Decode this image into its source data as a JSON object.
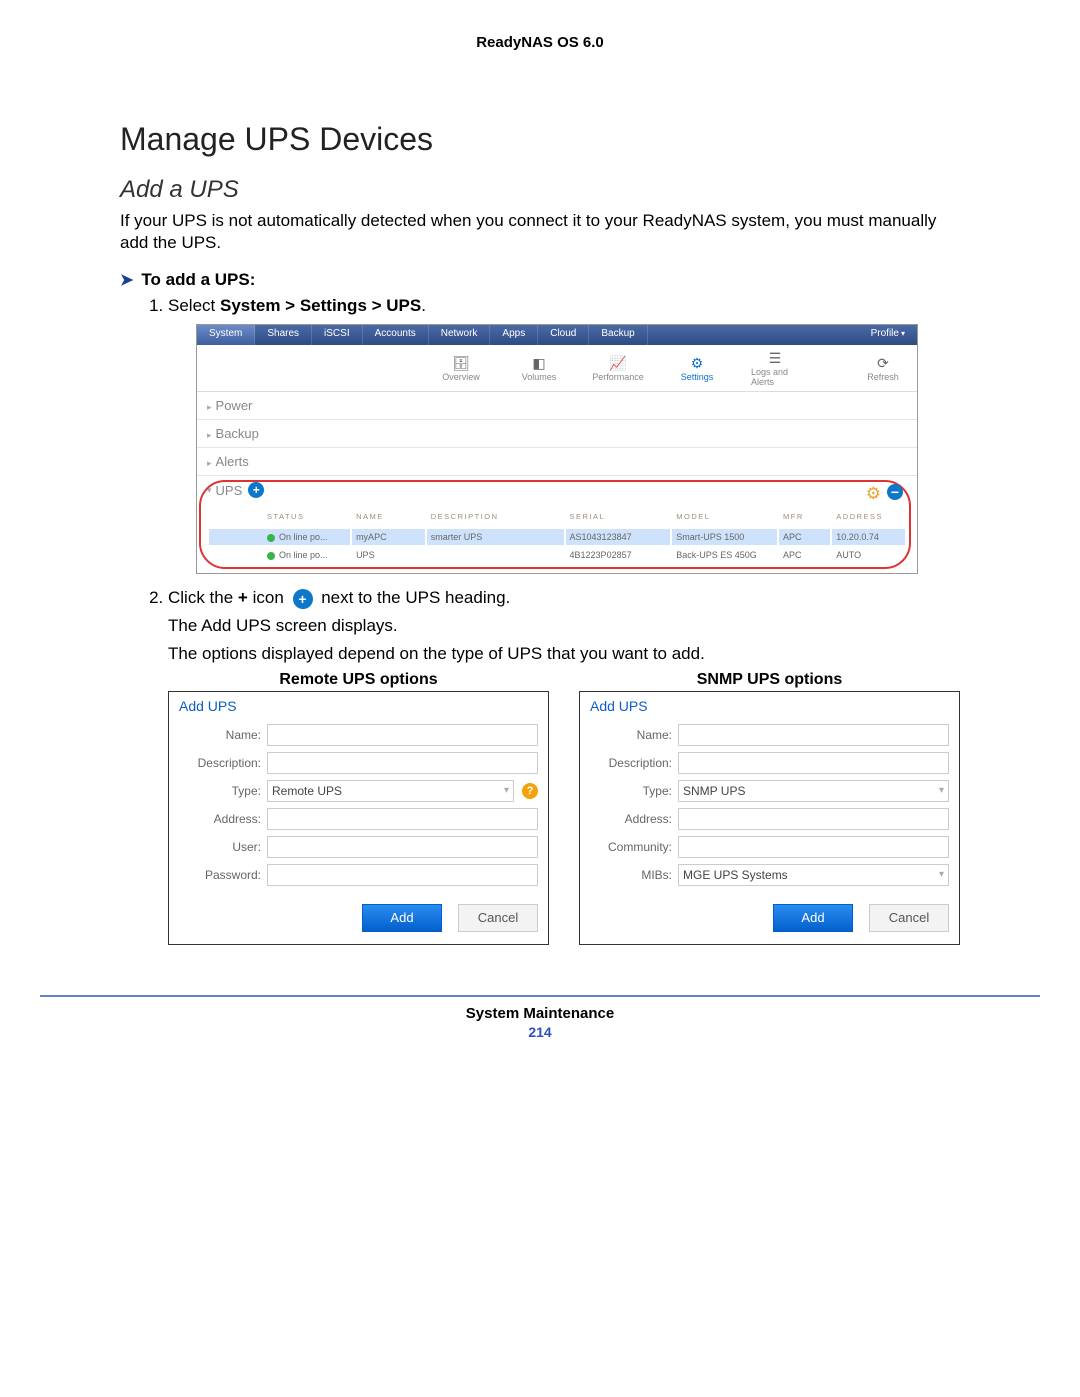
{
  "header": {
    "product": "ReadyNAS OS 6.0"
  },
  "h1": "Manage UPS Devices",
  "h2": "Add a UPS",
  "intro": "If your UPS is not automatically detected when you connect it to your ReadyNAS system, you must manually add the UPS.",
  "task_heading": "To add a UPS:",
  "step1_lead": "Select ",
  "step1_path": "System > Settings > UPS",
  "step1_tail": ".",
  "ui": {
    "tabs": [
      "System",
      "Shares",
      "iSCSI",
      "Accounts",
      "Network",
      "Apps",
      "Cloud",
      "Backup"
    ],
    "profile": "Profile",
    "iconbar": {
      "overview": "Overview",
      "volumes": "Volumes",
      "performance": "Performance",
      "settings": "Settings",
      "logs": "Logs and Alerts",
      "refresh": "Refresh"
    },
    "sections": [
      "Power",
      "Backup",
      "Alerts"
    ],
    "ups_label": "UPS",
    "table": {
      "headers": [
        "Status",
        "Name",
        "Description",
        "Serial",
        "Model",
        "Mfr",
        "Address"
      ],
      "rows": [
        {
          "status": "On line po...",
          "name": "myAPC",
          "desc": "smarter UPS",
          "serial": "AS1043123847",
          "model": "Smart-UPS 1500",
          "mfr": "APC",
          "addr": "10.20.0.74",
          "selected": true
        },
        {
          "status": "On line po...",
          "name": "UPS",
          "desc": "",
          "serial": "4B1223P02857",
          "model": "Back-UPS ES 450G",
          "mfr": "APC",
          "addr": "AUTO",
          "selected": false
        }
      ]
    }
  },
  "step2_a": "Click the ",
  "step2_b": "+",
  "step2_c": " icon ",
  "step2_d": " next to the UPS heading.",
  "step2_line2": "The Add UPS screen displays.",
  "step2_line3": "The options displayed depend on the type of UPS that you want to add.",
  "dialogs": {
    "remote_title": "Remote UPS options",
    "snmp_title": "SNMP UPS options",
    "remote": {
      "head": "Add UPS",
      "fields": {
        "name": "Name:",
        "desc": "Description:",
        "type": "Type:",
        "type_val": "Remote UPS",
        "addr": "Address:",
        "user": "User:",
        "pass": "Password:"
      },
      "add": "Add",
      "cancel": "Cancel"
    },
    "snmp": {
      "head": "Add UPS",
      "fields": {
        "name": "Name:",
        "desc": "Description:",
        "type": "Type:",
        "type_val": "SNMP UPS",
        "addr": "Address:",
        "comm": "Community:",
        "mibs": "MIBs:",
        "mibs_val": "MGE UPS Systems"
      },
      "add": "Add",
      "cancel": "Cancel"
    }
  },
  "footer": {
    "section": "System Maintenance",
    "page": "214"
  }
}
